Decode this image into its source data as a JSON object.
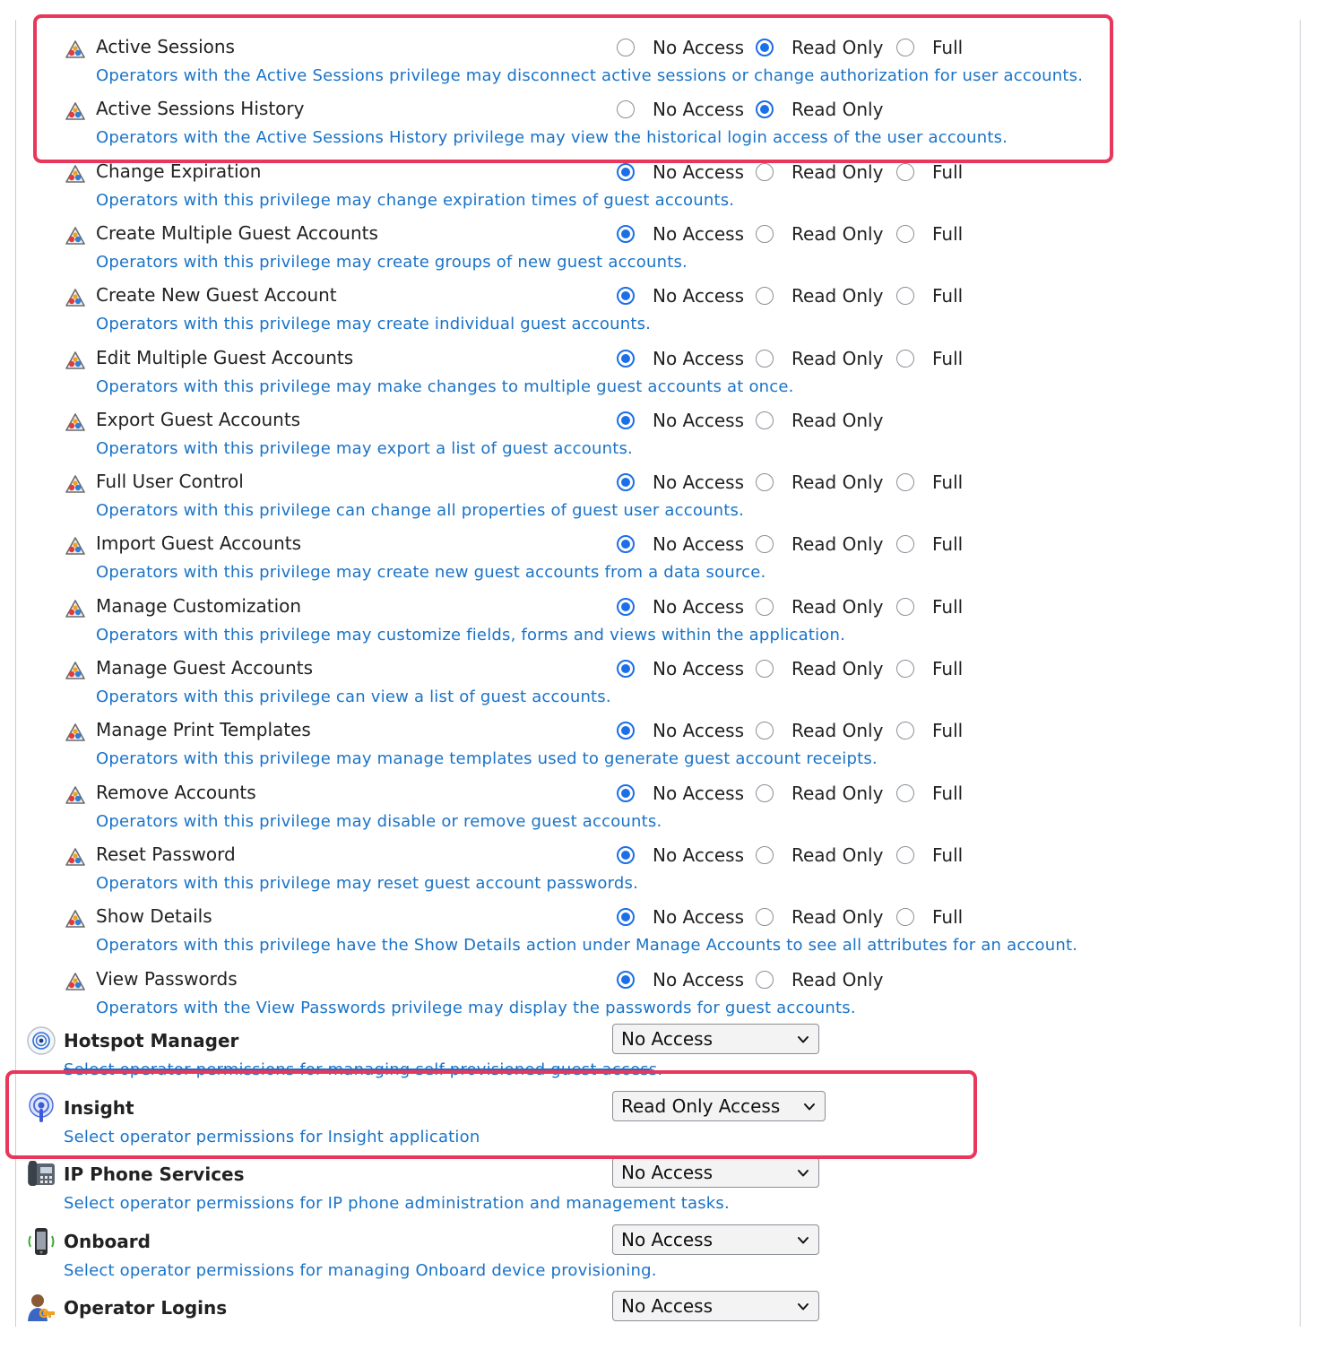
{
  "options": {
    "no_access": "No Access",
    "read_only": "Read Only",
    "full": "Full"
  },
  "privileges": [
    {
      "name": "Active Sessions",
      "desc": "Operators with the Active Sessions privilege may disconnect active sessions or change authorization for user accounts.",
      "selected": "read_only",
      "has_full": true
    },
    {
      "name": "Active Sessions History",
      "desc": "Operators with the Active Sessions History privilege may view the historical login access of the user accounts.",
      "selected": "read_only",
      "has_full": false
    },
    {
      "name": "Change Expiration",
      "desc": "Operators with this privilege may change expiration times of guest accounts.",
      "selected": "no_access",
      "has_full": true
    },
    {
      "name": "Create Multiple Guest Accounts",
      "desc": "Operators with this privilege may create groups of new guest accounts.",
      "selected": "no_access",
      "has_full": true
    },
    {
      "name": "Create New Guest Account",
      "desc": "Operators with this privilege may create individual guest accounts.",
      "selected": "no_access",
      "has_full": true
    },
    {
      "name": "Edit Multiple Guest Accounts",
      "desc": "Operators with this privilege may make changes to multiple guest accounts at once.",
      "selected": "no_access",
      "has_full": true
    },
    {
      "name": "Export Guest Accounts",
      "desc": "Operators with this privilege may export a list of guest accounts.",
      "selected": "no_access",
      "has_full": false
    },
    {
      "name": "Full User Control",
      "desc": "Operators with this privilege can change all properties of guest user accounts.",
      "selected": "no_access",
      "has_full": true
    },
    {
      "name": "Import Guest Accounts",
      "desc": "Operators with this privilege may create new guest accounts from a data source.",
      "selected": "no_access",
      "has_full": true
    },
    {
      "name": "Manage Customization",
      "desc": "Operators with this privilege may customize fields, forms and views within the application.",
      "selected": "no_access",
      "has_full": true
    },
    {
      "name": "Manage Guest Accounts",
      "desc": "Operators with this privilege can view a list of guest accounts.",
      "selected": "no_access",
      "has_full": true
    },
    {
      "name": "Manage Print Templates",
      "desc": "Operators with this privilege may manage templates used to generate guest account receipts.",
      "selected": "no_access",
      "has_full": true
    },
    {
      "name": "Remove Accounts",
      "desc": "Operators with this privilege may disable or remove guest accounts.",
      "selected": "no_access",
      "has_full": true
    },
    {
      "name": "Reset Password",
      "desc": "Operators with this privilege may reset guest account passwords.",
      "selected": "no_access",
      "has_full": true
    },
    {
      "name": "Show Details",
      "desc": "Operators with this privilege have the Show Details action under Manage Accounts to see all attributes for an account.",
      "selected": "no_access",
      "has_full": true
    },
    {
      "name": "View Passwords",
      "desc": "Operators with the View Passwords privilege may display the passwords for guest accounts.",
      "selected": "no_access",
      "has_full": false
    }
  ],
  "apps": [
    {
      "id": "hotspot",
      "name": "Hotspot Manager",
      "desc": "Select operator permissions for managing self-provisioned guest access.",
      "value": "No Access",
      "icon": "hotspot-icon"
    },
    {
      "id": "insight",
      "name": "Insight",
      "desc": "Select operator permissions for Insight application",
      "value": "Read Only Access",
      "icon": "insight-icon"
    },
    {
      "id": "ipphone",
      "name": "IP Phone Services",
      "desc": "Select operator permissions for IP phone administration and management tasks.",
      "value": "No Access",
      "icon": "ip-phone-icon"
    },
    {
      "id": "onboard",
      "name": "Onboard",
      "desc": "Select operator permissions for managing Onboard device provisioning.",
      "value": "No Access",
      "icon": "onboard-icon"
    },
    {
      "id": "oplogins",
      "name": "Operator Logins",
      "desc": "",
      "value": "No Access",
      "icon": "operator-logins-icon"
    }
  ],
  "colors": {
    "highlight": "#e8375b",
    "link_blue": "#1a73c7",
    "radio_blue": "#1c6fe6"
  }
}
